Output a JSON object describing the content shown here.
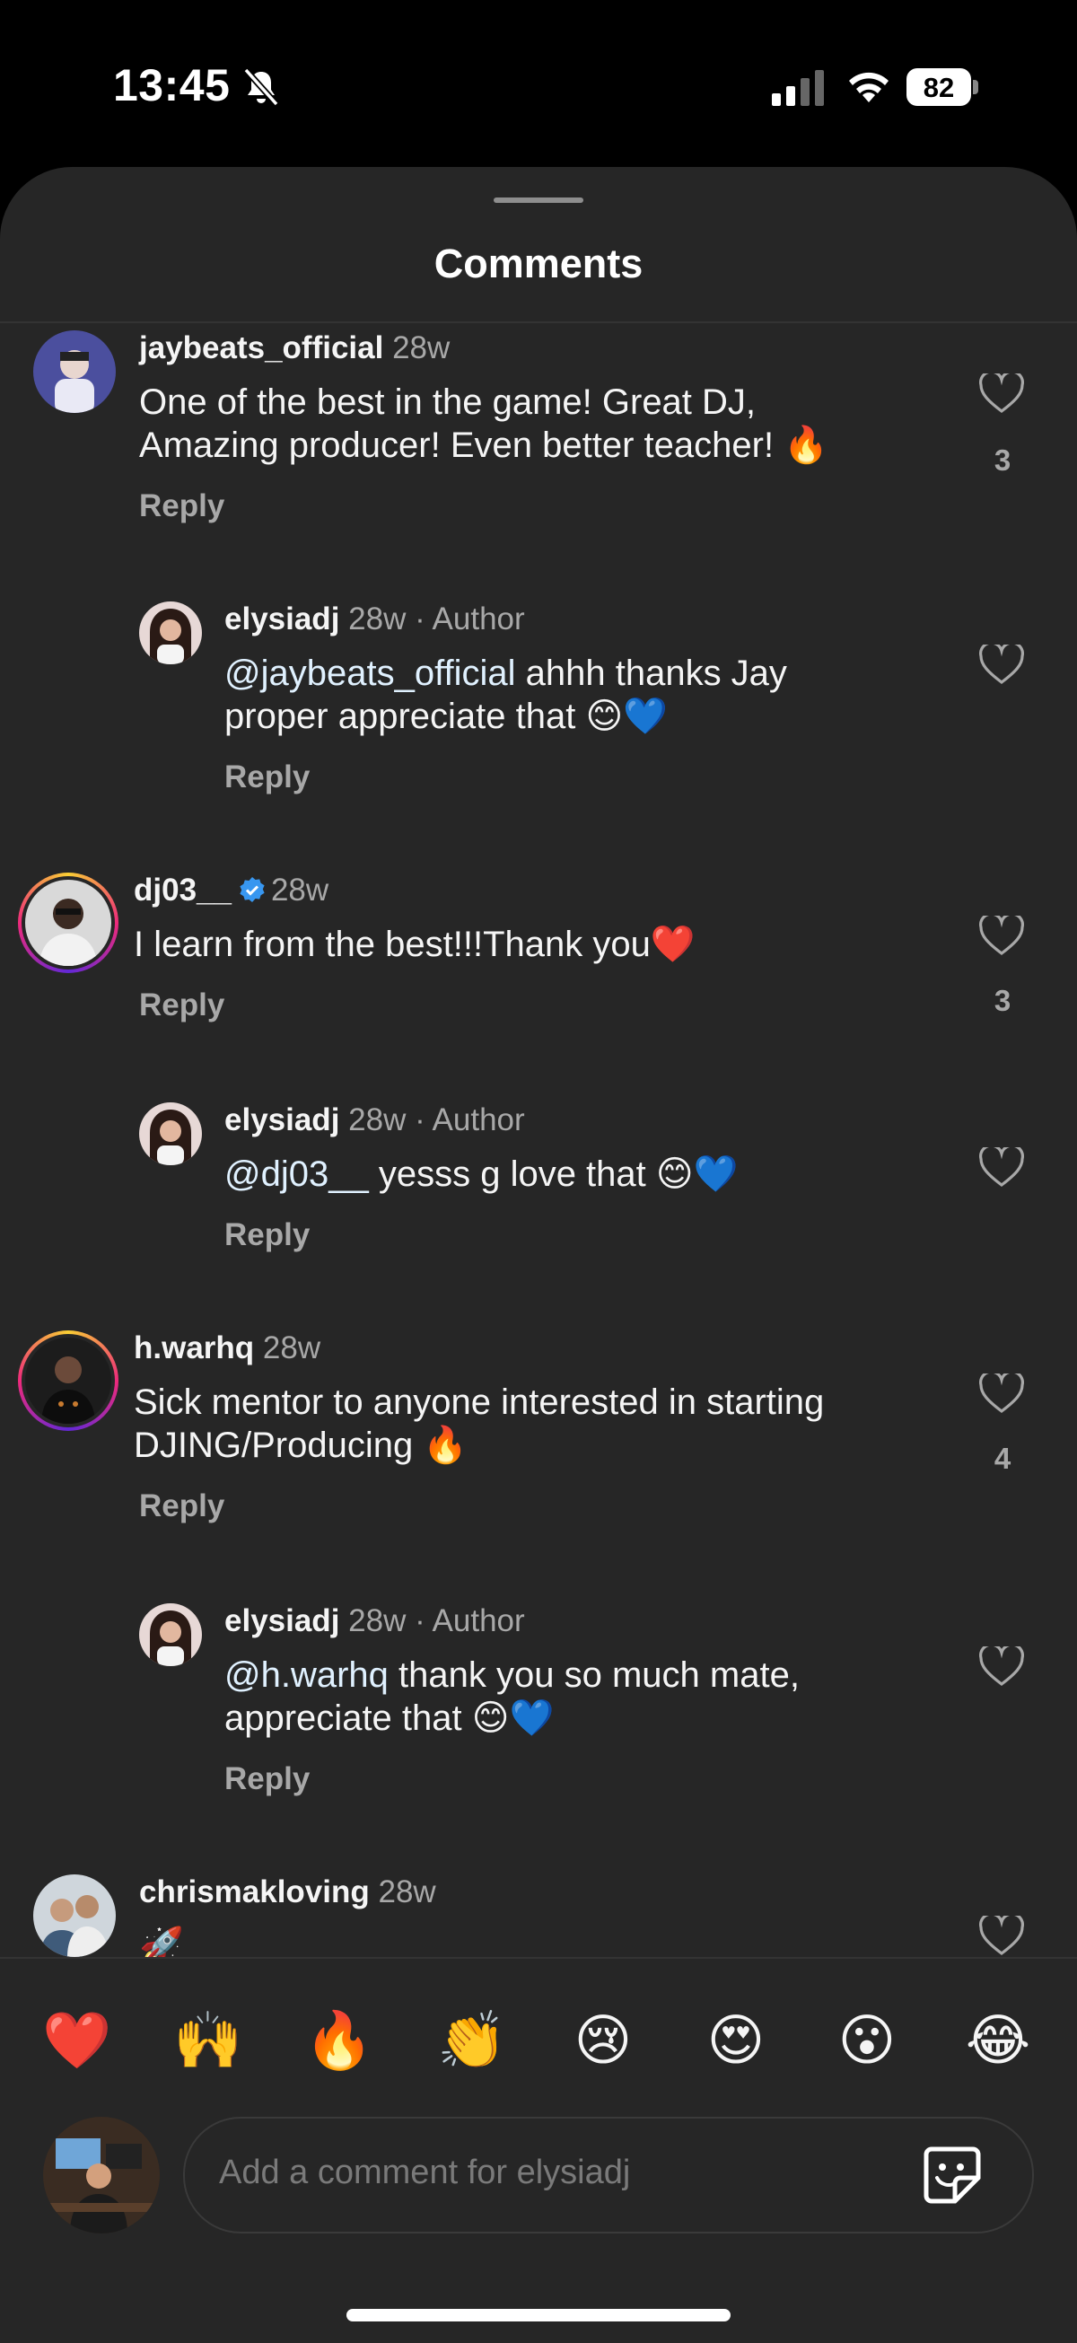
{
  "status_bar": {
    "time": "13:45",
    "battery": "82"
  },
  "sheet": {
    "title": "Comments"
  },
  "comments": [
    {
      "username": "jaybeats_official",
      "time": "28w",
      "text": "One of the best in the game! Great DJ,\nAmazing producer! Even better teacher! 🔥",
      "reply": "Reply",
      "likes": "3"
    },
    {
      "username": "elysiadj",
      "time": "28w",
      "author": "· Author",
      "mention": "@jaybeats_official",
      "text": " ahhh thanks Jay\nproper appreciate that 😊💙",
      "reply": "Reply"
    },
    {
      "username": "dj03__",
      "time": "28w",
      "text": "I learn from the best!!!Thank you❤️",
      "reply": "Reply",
      "likes": "3"
    },
    {
      "username": "elysiadj",
      "time": "28w",
      "author": "· Author",
      "mention": "@dj03__",
      "text": " yesss g love that 😊💙",
      "reply": "Reply"
    },
    {
      "username": "h.warhq",
      "time": "28w",
      "text": "Sick mentor to anyone interested in starting\nDJING/Producing 🔥",
      "reply": "Reply",
      "likes": "4"
    },
    {
      "username": "elysiadj",
      "time": "28w",
      "author": "· Author",
      "mention": "@h.warhq",
      "text": " thank you so much mate,\nappreciate that 😊💙",
      "reply": "Reply"
    },
    {
      "username": "chrismakloving",
      "time": "28w",
      "text": "🚀"
    }
  ],
  "reactions": [
    "❤️",
    "🙌",
    "🔥",
    "👏",
    "😢",
    "😍",
    "😮",
    "😂"
  ],
  "composer": {
    "placeholder": "Add a comment for elysiadj"
  },
  "icons": {
    "mute": "bell-slash-icon",
    "signal": "cellular-signal-icon",
    "wifi": "wifi-icon",
    "like": "heart-outline-icon",
    "verified": "verified-badge-icon",
    "sticker": "sticker-icon"
  },
  "colors": {
    "background": "#262626",
    "text": "#f5f5f5",
    "muted": "#a8a8a8",
    "verified": "#3897f0"
  }
}
